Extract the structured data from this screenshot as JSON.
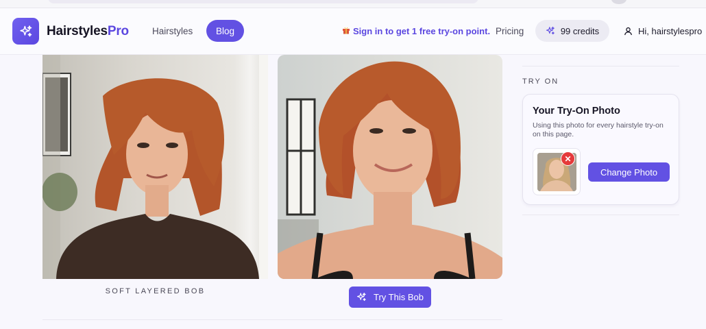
{
  "header": {
    "brand_main": "Hairstyles",
    "brand_accent": "Pro",
    "nav": [
      {
        "label": "Hairstyles"
      },
      {
        "label": "Blog",
        "active": true
      }
    ],
    "signin_text": "Sign in to get 1 free try-on point.",
    "pricing_label": "Pricing",
    "credits_label": "99 credits",
    "user_greeting": "Hi, hairstylespro"
  },
  "main": {
    "left_caption": "SOFT LAYERED BOB",
    "try_button_label": "Try This Bob",
    "left_photo_icon": "woman-portrait-brown-sweater",
    "right_photo_icon": "woman-portrait-smiling"
  },
  "sidebar": {
    "section_label": "TRY ON",
    "card_title": "Your Try-On Photo",
    "card_description": "Using this photo for every hairstyle try-on on this page.",
    "change_button_label": "Change Photo",
    "remove_icon": "close-icon"
  },
  "colors": {
    "accent": "#6251e3",
    "accent_text": "#5b47e0",
    "danger": "#e53a3a",
    "background": "#f8f7fd"
  }
}
